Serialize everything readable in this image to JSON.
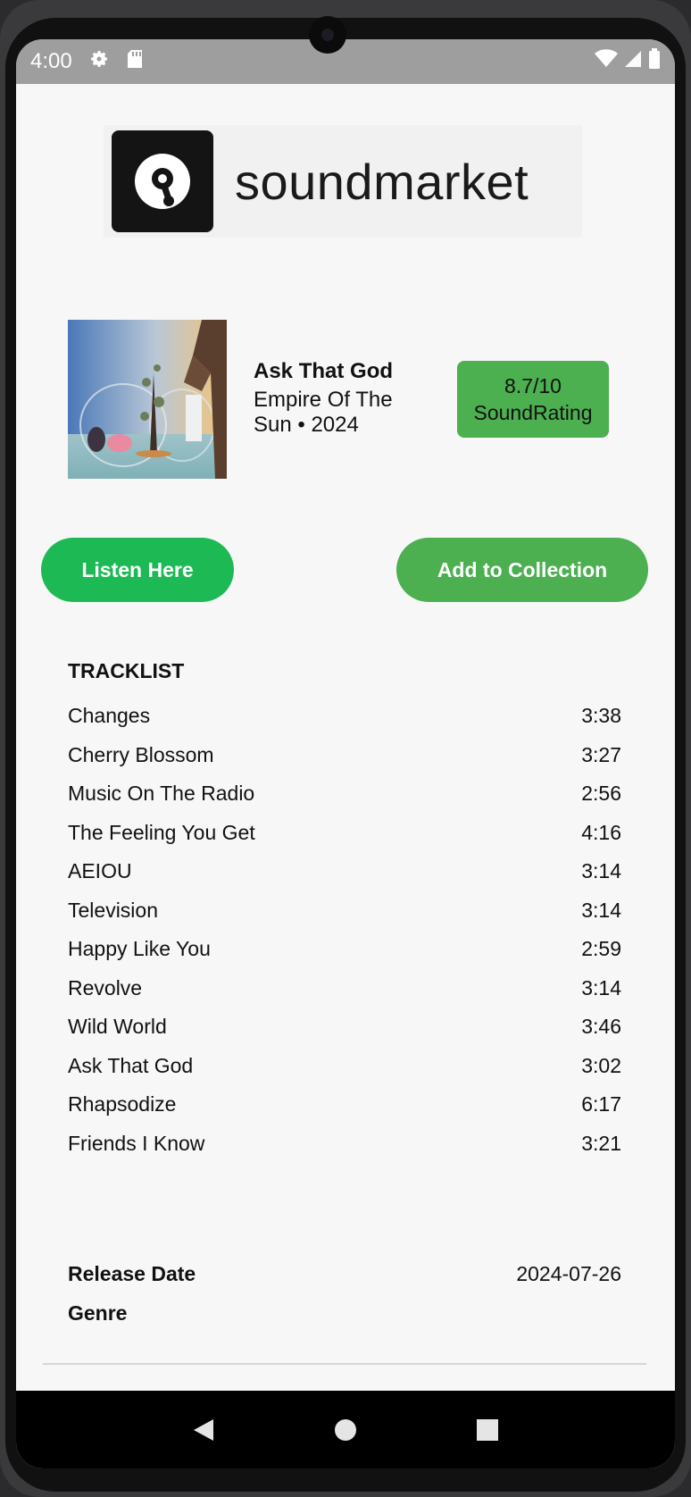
{
  "status_bar": {
    "time": "4:00",
    "icons": [
      "gear-icon",
      "sd-card-icon"
    ],
    "right_icons": [
      "wifi-icon",
      "signal-icon",
      "battery-icon"
    ]
  },
  "logo": {
    "text": "soundmarket"
  },
  "album": {
    "title": "Ask That God",
    "artist_year": "Empire Of The Sun • 2024",
    "rating_value": "8.7/10",
    "rating_label": "SoundRating"
  },
  "buttons": {
    "listen": "Listen Here",
    "collect": "Add to Collection"
  },
  "tracklist": {
    "heading": "TRACKLIST",
    "tracks": [
      {
        "title": "Changes",
        "duration": "3:38"
      },
      {
        "title": "Cherry Blossom",
        "duration": "3:27"
      },
      {
        "title": "Music On The Radio",
        "duration": "2:56"
      },
      {
        "title": "The Feeling You Get",
        "duration": "4:16"
      },
      {
        "title": "AEIOU",
        "duration": "3:14"
      },
      {
        "title": "Television",
        "duration": "3:14"
      },
      {
        "title": "Happy Like You",
        "duration": "2:59"
      },
      {
        "title": "Revolve",
        "duration": "3:14"
      },
      {
        "title": "Wild World",
        "duration": "3:46"
      },
      {
        "title": "Ask That God",
        "duration": "3:02"
      },
      {
        "title": "Rhapsodize",
        "duration": "6:17"
      },
      {
        "title": "Friends I Know",
        "duration": "3:21"
      }
    ]
  },
  "details": {
    "release_label": "Release Date",
    "release_value": "2024-07-26",
    "genre_label": "Genre",
    "genre_value": ""
  },
  "nav": {
    "icons": [
      "back-icon",
      "home-icon",
      "recents-icon"
    ]
  },
  "colors": {
    "listen_button": "#1db954",
    "collect_button": "#4caf50",
    "rating_badge": "#4caf50",
    "status_bar": "#9e9e9e"
  }
}
